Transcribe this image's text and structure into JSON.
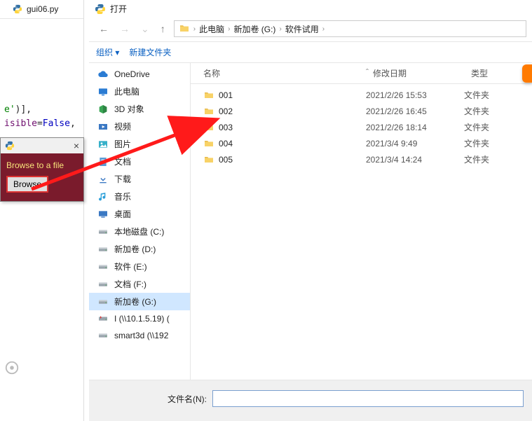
{
  "editor": {
    "tab_filename": "gui06.py",
    "code_line1_a": "e'",
    "code_line1_b": ")],",
    "code_line2_a": "isible",
    "code_line2_b": "=",
    "code_line2_c": "False",
    "code_line2_d": ","
  },
  "mini_window": {
    "prompt": "Browse to a file",
    "button": "Browse",
    "close": "×"
  },
  "dialog": {
    "title": "打开",
    "nav_back": "←",
    "nav_fwd": "→",
    "nav_up": "↑",
    "breadcrumb": [
      "此电脑",
      "新加卷 (G:)",
      "软件试用"
    ],
    "toolbar": {
      "organize": "组织 ▾",
      "newfolder": "新建文件夹"
    },
    "sidebar": [
      {
        "label": "OneDrive",
        "icon": "cloud"
      },
      {
        "label": "此电脑",
        "icon": "pc"
      },
      {
        "label": "3D 对象",
        "icon": "3d"
      },
      {
        "label": "视频",
        "icon": "video"
      },
      {
        "label": "图片",
        "icon": "pics"
      },
      {
        "label": "文档",
        "icon": "docs"
      },
      {
        "label": "下载",
        "icon": "dl"
      },
      {
        "label": "音乐",
        "icon": "music"
      },
      {
        "label": "桌面",
        "icon": "desktop"
      },
      {
        "label": "本地磁盘 (C:)",
        "icon": "disk"
      },
      {
        "label": "新加卷 (D:)",
        "icon": "disk"
      },
      {
        "label": "软件 (E:)",
        "icon": "disk"
      },
      {
        "label": "文档 (F:)",
        "icon": "disk"
      },
      {
        "label": "新加卷 (G:)",
        "icon": "disk",
        "selected": true
      },
      {
        "label": "I (\\\\10.1.5.19) (",
        "icon": "netdisk"
      },
      {
        "label": "smart3d (\\\\192",
        "icon": "disk"
      }
    ],
    "columns": {
      "name": "名称",
      "date": "修改日期",
      "type": "类型"
    },
    "rows": [
      {
        "name": "001",
        "date": "2021/2/26 15:53",
        "type": "文件夹"
      },
      {
        "name": "002",
        "date": "2021/2/26 16:45",
        "type": "文件夹"
      },
      {
        "name": "003",
        "date": "2021/2/26 18:14",
        "type": "文件夹"
      },
      {
        "name": "004",
        "date": "2021/3/4 9:49",
        "type": "文件夹"
      },
      {
        "name": "005",
        "date": "2021/3/4 14:24",
        "type": "文件夹"
      }
    ],
    "filename_label": "文件名(N):",
    "filename_value": ""
  }
}
